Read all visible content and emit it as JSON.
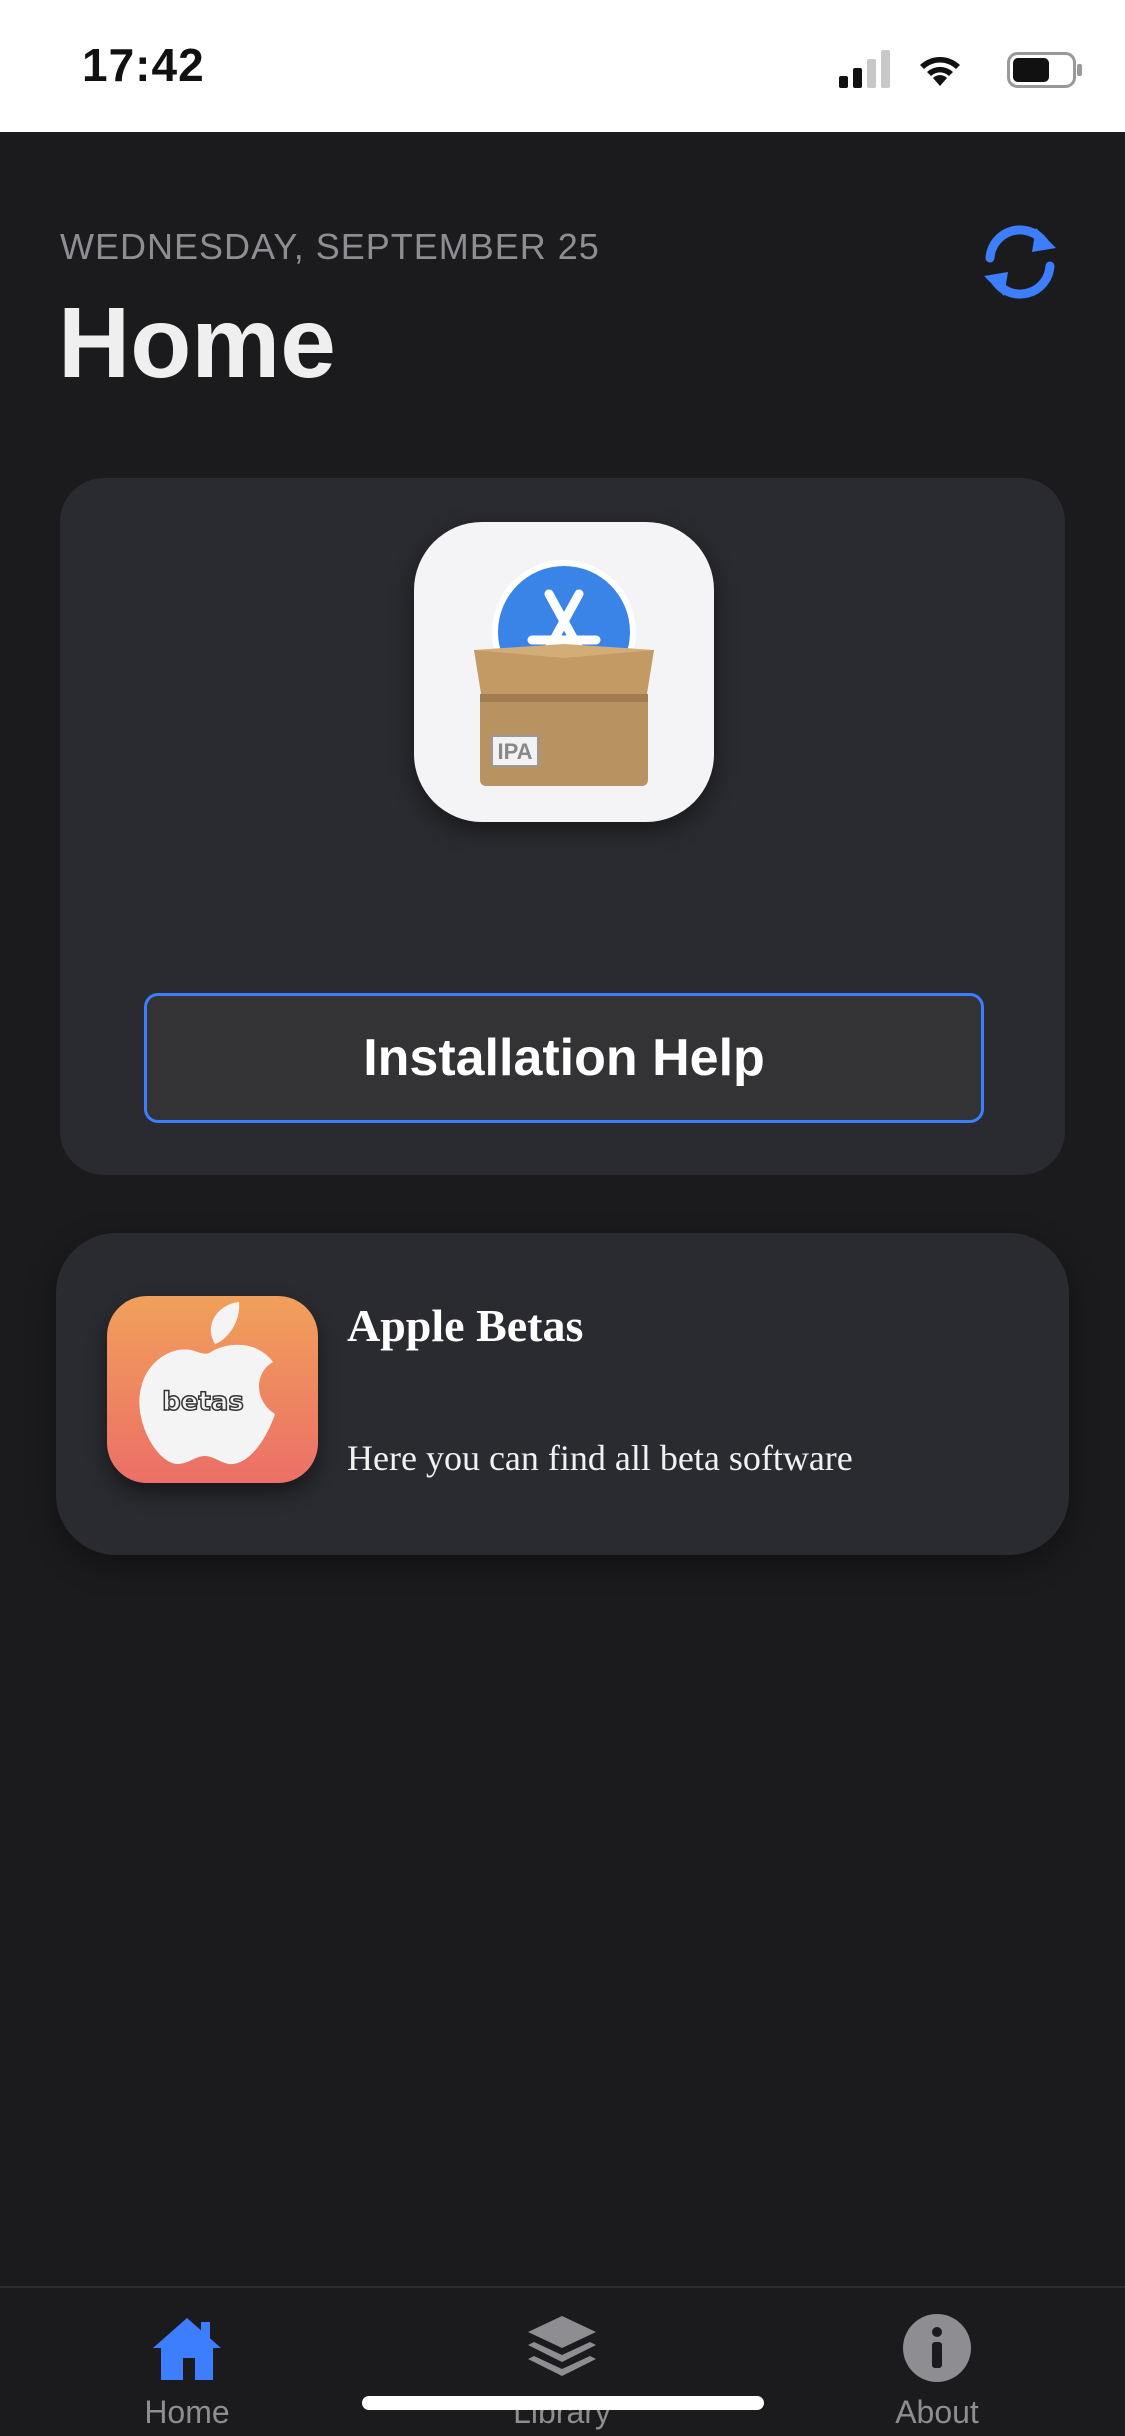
{
  "status_bar": {
    "time": "17:42"
  },
  "header": {
    "date": "WEDNESDAY, SEPTEMBER 25",
    "title": "Home"
  },
  "install_card": {
    "icon_badge": "IPA",
    "button_label": "Installation Help"
  },
  "betas_card": {
    "icon_text": "betas",
    "title": "Apple Betas",
    "description": "Here you can find all beta software"
  },
  "tabs": [
    {
      "label": "Home",
      "icon": "house-icon"
    },
    {
      "label": "Library",
      "icon": "stack-icon"
    },
    {
      "label": "About",
      "icon": "info-icon"
    }
  ],
  "colors": {
    "accent": "#3d7eff",
    "background": "#1b1b1d",
    "card": "#2a2b30"
  }
}
